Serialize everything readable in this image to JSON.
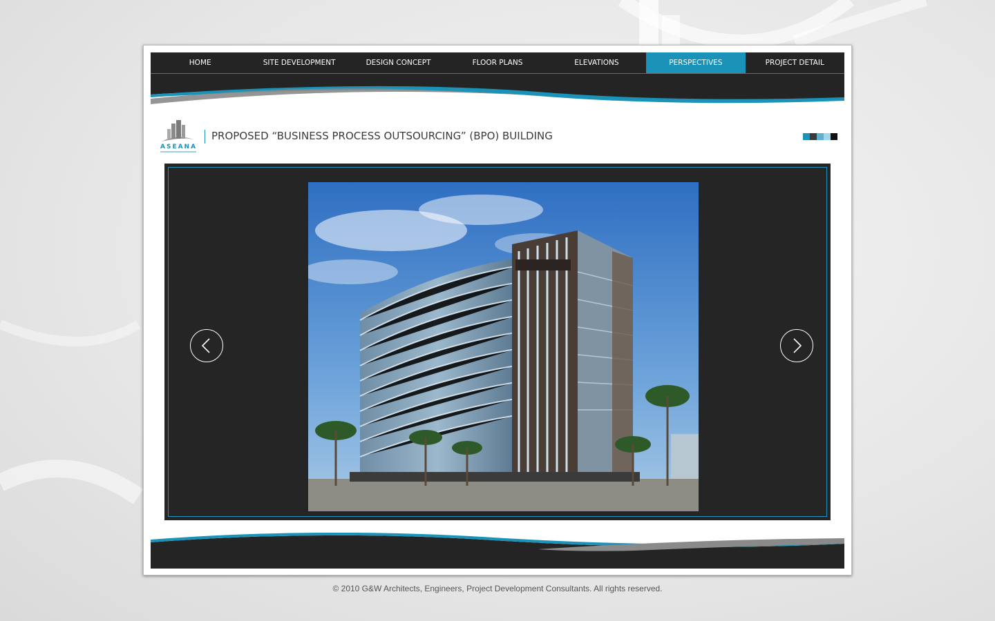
{
  "nav": {
    "items": [
      {
        "label": "HOME"
      },
      {
        "label": "SITE DEVELOPMENT"
      },
      {
        "label": "DESIGN CONCEPT"
      },
      {
        "label": "FLOOR PLANS"
      },
      {
        "label": "ELEVATIONS"
      },
      {
        "label": "PERSPECTIVES"
      },
      {
        "label": "PROJECT DETAIL"
      }
    ],
    "active_index": 5
  },
  "header": {
    "logo_text": "ASEANA",
    "title": "PROPOSED “BUSINESS PROCESS OUTSOURCING” (BPO) BUILDING",
    "swatch_colors": [
      "#1b93b8",
      "#3a3a3a",
      "#5fb0cc",
      "#9fd6e8",
      "#111111"
    ]
  },
  "viewer": {
    "prev_icon": "chevron-left-icon",
    "next_icon": "chevron-right-icon",
    "image_subject": "building-rendering"
  },
  "footer": {
    "copyright": "© 2010 G&W Architects, Engineers, Project Development Consultants. All rights reserved."
  },
  "colors": {
    "accent": "#1b93b8",
    "dark": "#242424",
    "frame_bg": "#ffffff"
  }
}
